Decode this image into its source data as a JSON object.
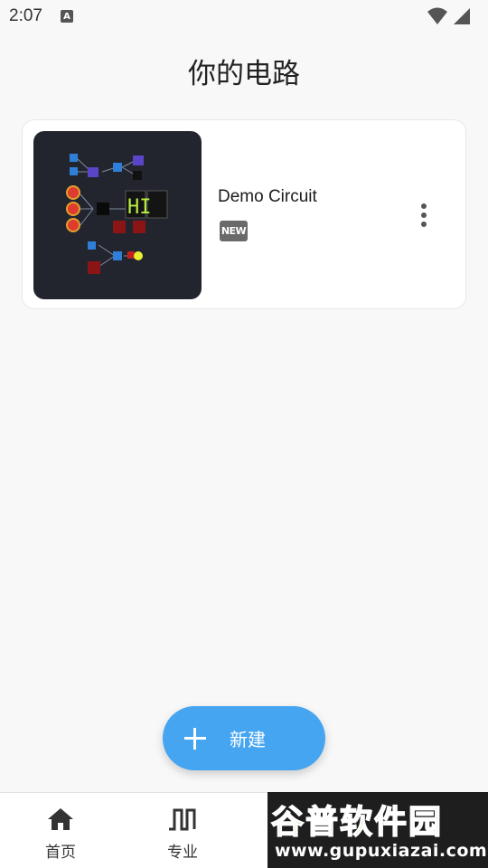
{
  "status_bar": {
    "time": "2:07",
    "notification_letter": "A",
    "icons": [
      "wifi-icon",
      "signal-icon"
    ]
  },
  "page": {
    "title": "你的电路"
  },
  "circuits": [
    {
      "name": "Demo Circuit",
      "badge": "NEW",
      "thumbnail_display_text": "HI",
      "more_icon": "more-vert-icon"
    }
  ],
  "fab": {
    "label": "新建",
    "icon": "plus-icon"
  },
  "bottom_nav": {
    "items": [
      {
        "label": "首页",
        "icon": "home-icon"
      },
      {
        "label": "专业",
        "icon": "square-wave-icon"
      }
    ]
  },
  "watermark": {
    "title": "谷普软件园",
    "url": "www.gupuxiazai.com"
  },
  "colors": {
    "accent": "#45a5f1",
    "background": "#f8f8f8",
    "thumbnail_bg": "#23252e",
    "watermark_green": "#55c82a"
  }
}
